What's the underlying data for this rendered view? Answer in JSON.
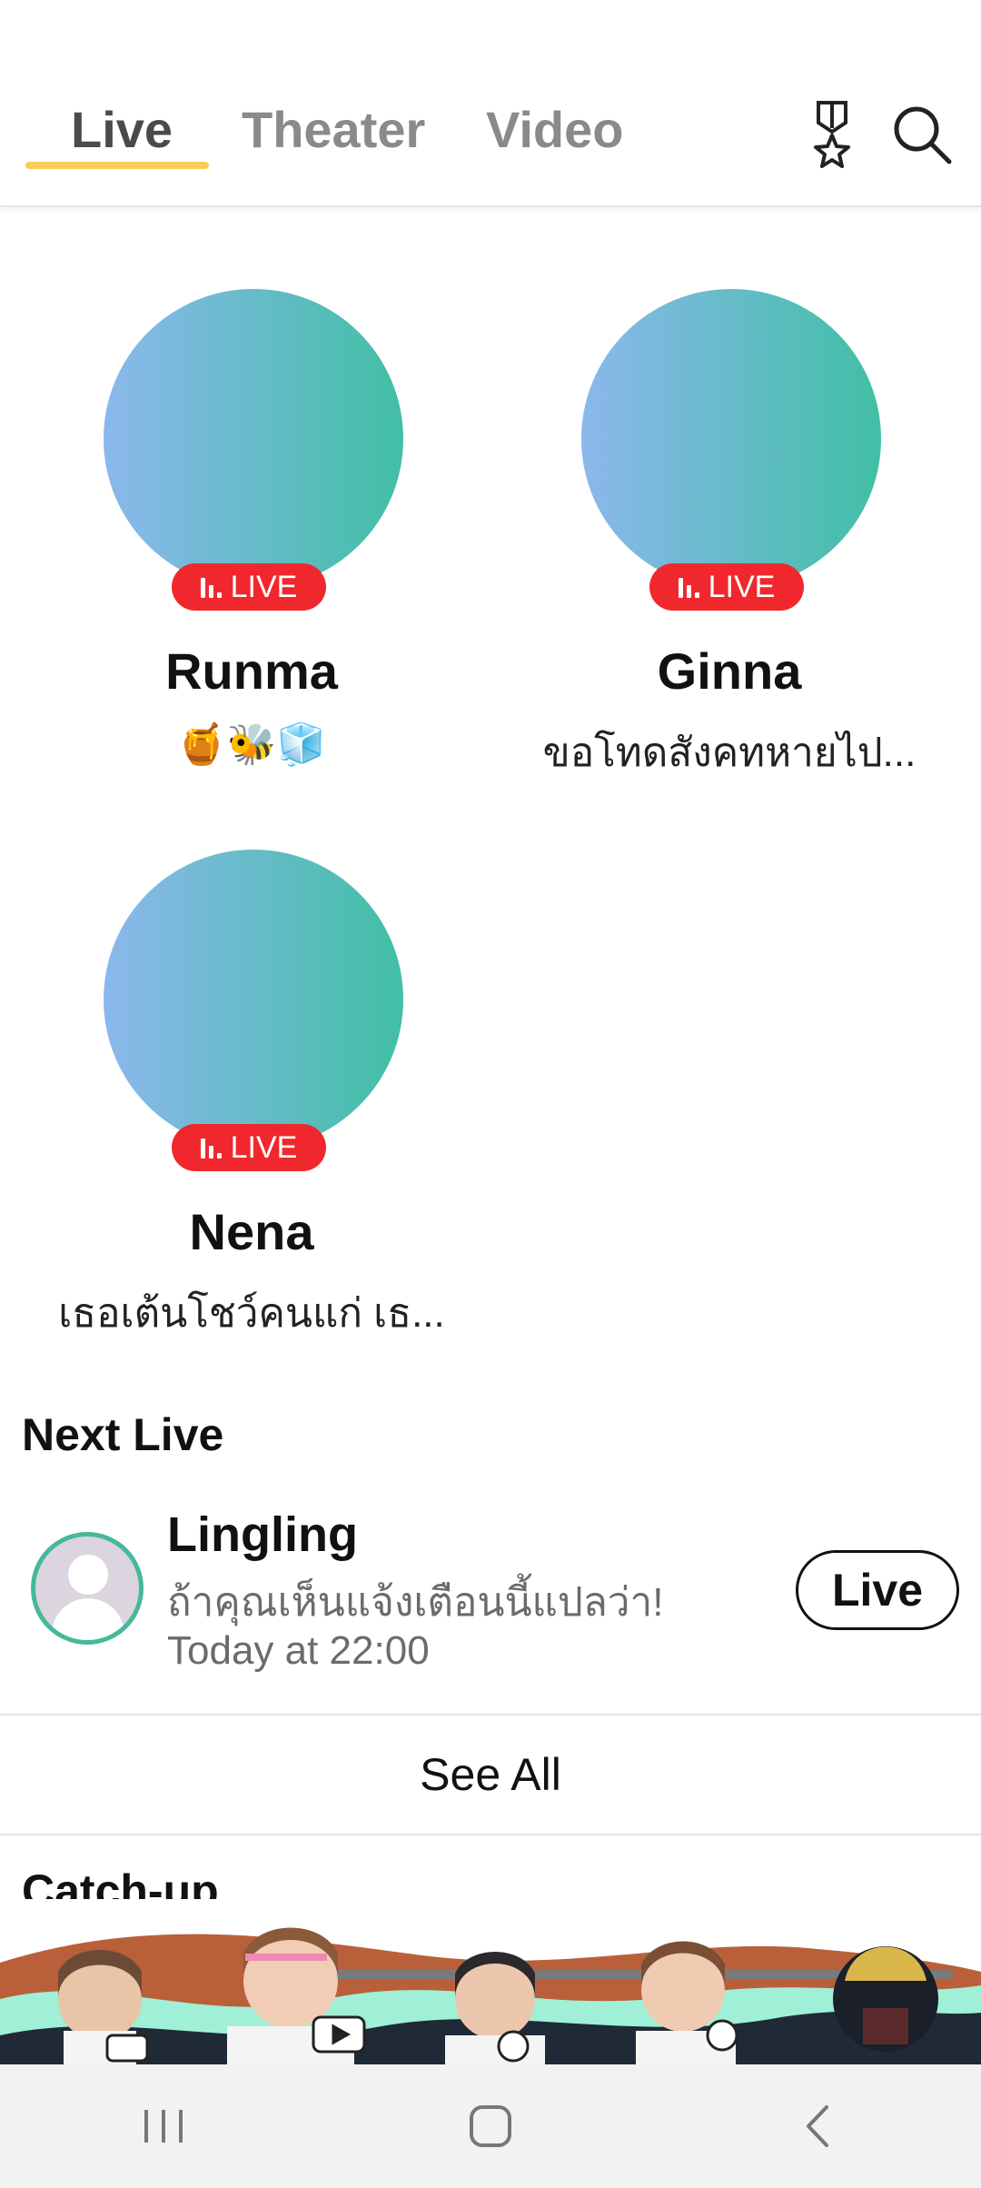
{
  "tabs": [
    {
      "label": "Live",
      "active": true
    },
    {
      "label": "Theater",
      "active": false
    },
    {
      "label": "Video",
      "active": false
    }
  ],
  "live_badge_label": "LIVE",
  "live_cards": [
    {
      "name": "Runma",
      "subtitle": "🍯🐝🧊"
    },
    {
      "name": "Ginna",
      "subtitle": "ขอโทดสังคทหายไป..."
    },
    {
      "name": "Nena",
      "subtitle": "เธอเต้นโชว์คนแก่ เธ..."
    }
  ],
  "next_live": {
    "title": "Next Live",
    "name": "Lingling",
    "description": "ถ้าคุณเห็นแจ้งเตือนนี้แปลว่า!",
    "time": "Today at 22:00",
    "button_label": "Live"
  },
  "see_all_label": "See All",
  "catchup_title": "Catch-up",
  "colors": {
    "accent": "#f6cf5b",
    "live_red": "#f0282d",
    "gradient_start": "#8bb8ec",
    "gradient_end": "#41bfa5",
    "ring_green": "#45b99a"
  }
}
